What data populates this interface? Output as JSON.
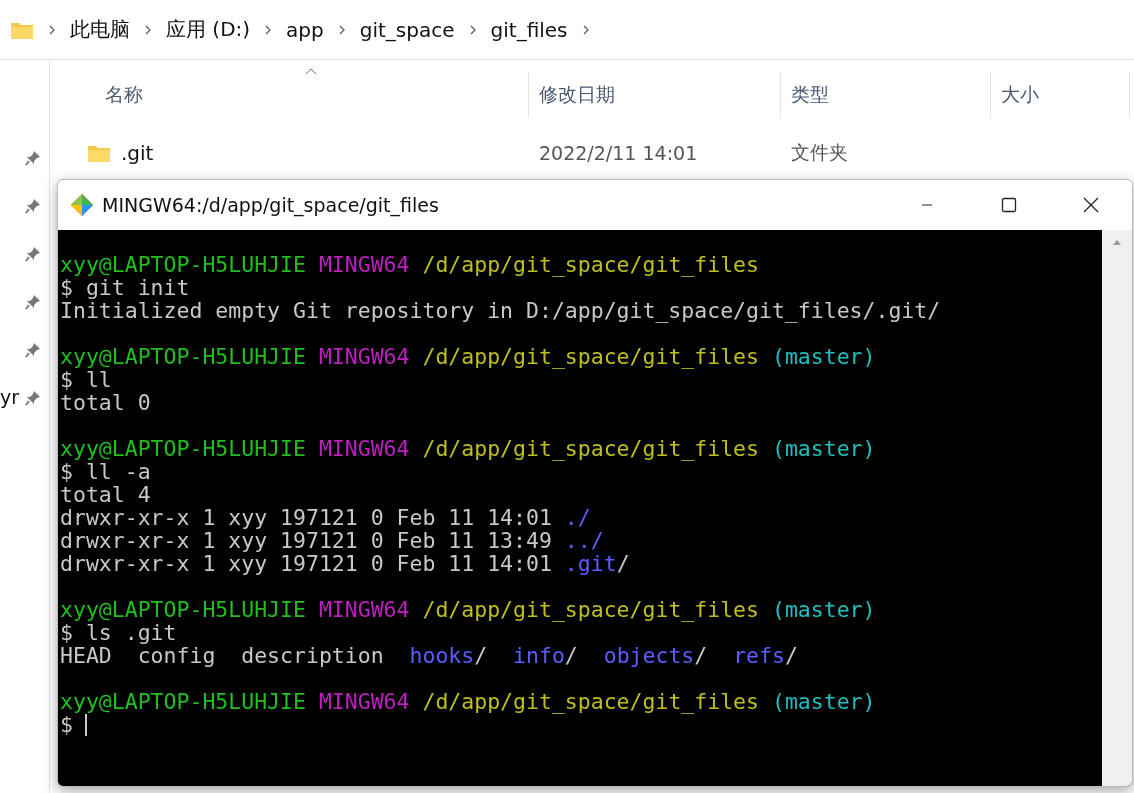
{
  "breadcrumb": [
    "此电脑",
    "应用 (D:)",
    "app",
    "git_space",
    "git_files"
  ],
  "columns": [
    "名称",
    "修改日期",
    "类型",
    "大小"
  ],
  "rows": [
    {
      "name": ".git",
      "date": "2022/2/11 14:01",
      "type": "文件夹"
    }
  ],
  "sidebar": {
    "items": [
      {
        "pinned": true
      },
      {
        "pinned": true
      },
      {
        "pinned": true
      },
      {
        "pinned": true
      },
      {
        "pinned": true
      },
      {
        "label": "yr",
        "pinned": true
      }
    ]
  },
  "terminal": {
    "title": "MINGW64:/d/app/git_space/git_files",
    "lines": [
      {
        "segments": [
          {
            "text": "xyy@LAPTOP-H5LUHJIE",
            "kind": "user"
          },
          {
            "text": " MINGW64",
            "kind": "shell"
          },
          {
            "text": " /d/app/git_space/git_files",
            "kind": "path"
          }
        ]
      },
      {
        "segments": [
          {
            "text": "$ git init",
            "kind": "plain"
          }
        ]
      },
      {
        "segments": [
          {
            "text": "Initialized empty Git repository in D:/app/git_space/git_files/.git/",
            "kind": "plain"
          }
        ]
      },
      {
        "kind": "blank"
      },
      {
        "segments": [
          {
            "text": "xyy@LAPTOP-H5LUHJIE",
            "kind": "user"
          },
          {
            "text": " MINGW64",
            "kind": "shell"
          },
          {
            "text": " /d/app/git_space/git_files",
            "kind": "path"
          },
          {
            "text": " (master)",
            "kind": "branch"
          }
        ]
      },
      {
        "segments": [
          {
            "text": "$ ll",
            "kind": "plain"
          }
        ]
      },
      {
        "segments": [
          {
            "text": "total 0",
            "kind": "plain"
          }
        ]
      },
      {
        "kind": "blank"
      },
      {
        "segments": [
          {
            "text": "xyy@LAPTOP-H5LUHJIE",
            "kind": "user"
          },
          {
            "text": " MINGW64",
            "kind": "shell"
          },
          {
            "text": " /d/app/git_space/git_files",
            "kind": "path"
          },
          {
            "text": " (master)",
            "kind": "branch"
          }
        ]
      },
      {
        "segments": [
          {
            "text": "$ ll -a",
            "kind": "plain"
          }
        ]
      },
      {
        "segments": [
          {
            "text": "total 4",
            "kind": "plain"
          }
        ]
      },
      {
        "segments": [
          {
            "text": "drwxr-xr-x 1 xyy 197121 0 Feb 11 14:01",
            "kind": "plain"
          },
          {
            "text": " ./",
            "kind": "dir"
          }
        ]
      },
      {
        "segments": [
          {
            "text": "drwxr-xr-x 1 xyy 197121 0 Feb 11 13:49",
            "kind": "plain"
          },
          {
            "text": " ../",
            "kind": "dir"
          }
        ]
      },
      {
        "segments": [
          {
            "text": "drwxr-xr-x 1 xyy 197121 0 Feb 11 14:01",
            "kind": "plain"
          },
          {
            "text": " .git",
            "kind": "dir"
          },
          {
            "text": "/",
            "kind": "plain"
          }
        ]
      },
      {
        "kind": "blank"
      },
      {
        "segments": [
          {
            "text": "xyy@LAPTOP-H5LUHJIE",
            "kind": "user"
          },
          {
            "text": " MINGW64",
            "kind": "shell"
          },
          {
            "text": " /d/app/git_space/git_files",
            "kind": "path"
          },
          {
            "text": " (master)",
            "kind": "branch"
          }
        ]
      },
      {
        "segments": [
          {
            "text": "$ ls .git",
            "kind": "plain"
          }
        ]
      },
      {
        "segments": [
          {
            "text": "HEAD  config  description",
            "kind": "plain"
          },
          {
            "text": "  hooks",
            "kind": "dir"
          },
          {
            "text": "/",
            "kind": "plain"
          },
          {
            "text": "  info",
            "kind": "dir"
          },
          {
            "text": "/",
            "kind": "plain"
          },
          {
            "text": "  objects",
            "kind": "dir"
          },
          {
            "text": "/",
            "kind": "plain"
          },
          {
            "text": "  refs",
            "kind": "dir"
          },
          {
            "text": "/",
            "kind": "plain"
          }
        ]
      },
      {
        "kind": "blank"
      },
      {
        "segments": [
          {
            "text": "xyy@LAPTOP-H5LUHJIE",
            "kind": "user"
          },
          {
            "text": " MINGW64",
            "kind": "shell"
          },
          {
            "text": " /d/app/git_space/git_files",
            "kind": "path"
          },
          {
            "text": " (master)",
            "kind": "branch"
          }
        ]
      },
      {
        "kind": "cursor",
        "segments": [
          {
            "text": "$",
            "kind": "plain"
          }
        ]
      }
    ]
  }
}
